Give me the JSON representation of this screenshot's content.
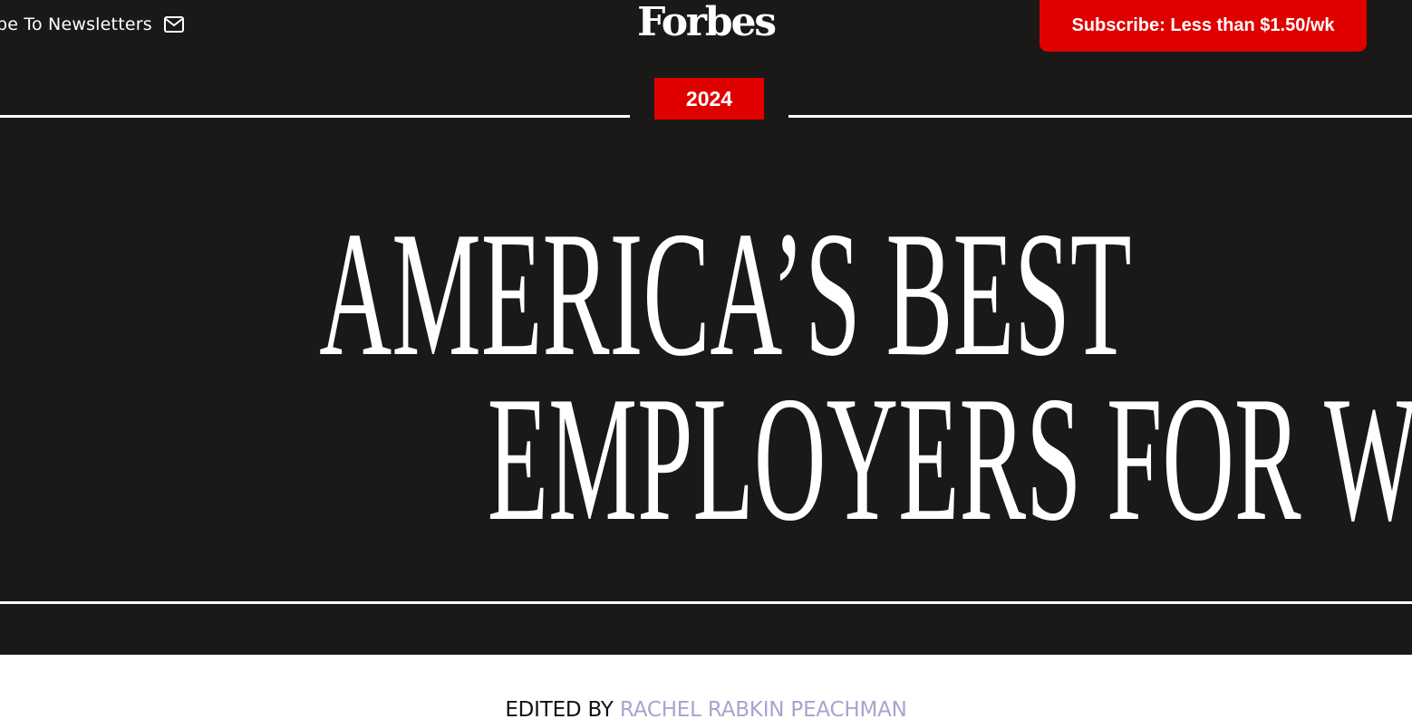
{
  "header": {
    "newsletter_label": "be To Newsletters",
    "newsletter_icon": "mail-icon",
    "logo_text": "Forbes",
    "subscribe_label": "Subscribe: Less than $1.50/wk"
  },
  "hero": {
    "year": "2024",
    "headline_line_1": "AMERICA’S BEST",
    "headline_line_2": "EMPLOYERS FOR WOMEN"
  },
  "byline": {
    "prefix": "EDITED BY",
    "author": "RACHEL RABKIN PEACHMAN"
  },
  "colors": {
    "hero_background": "#1a1918",
    "accent_red": "#e00000",
    "author_link": "#a9a3cf",
    "text_white": "#ffffff"
  }
}
